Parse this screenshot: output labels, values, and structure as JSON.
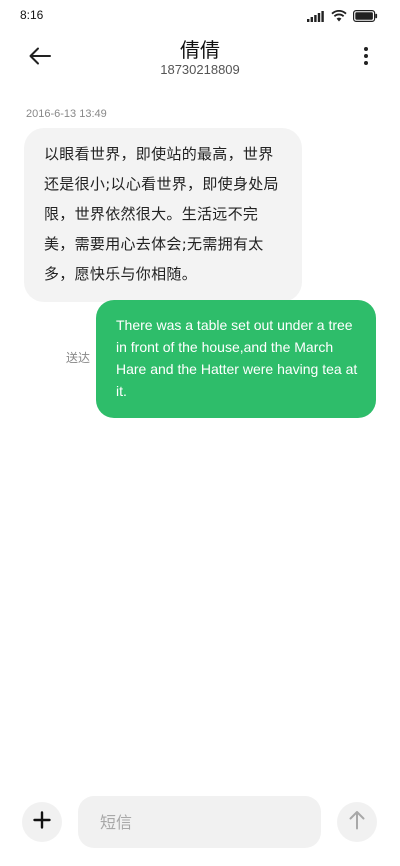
{
  "status_bar": {
    "time": "8:16",
    "signal_icon": "signal-icon",
    "wifi_icon": "wifi-icon",
    "battery_icon": "battery-icon"
  },
  "header": {
    "back_icon": "arrow-left-icon",
    "contact_name": "倩倩",
    "contact_number": "18730218809",
    "more_icon": "more-vertical-icon"
  },
  "conversation": {
    "timestamp": "2016-6-13  13:49",
    "messages": [
      {
        "direction": "incoming",
        "text": "以眼看世界，即使站的最高，世界还是很小;以心看世界，即使身处局限，世界依然很大。生活远不完美，需要用心去体会;无需拥有太多，愿快乐与你相随。"
      },
      {
        "direction": "outgoing",
        "status": "送达",
        "text": "There was a table set out under a tree in front of the house,and the March Hare and the Hatter were having tea at it."
      }
    ]
  },
  "composer": {
    "add_icon": "plus-icon",
    "placeholder": "短信",
    "value": "",
    "send_icon": "arrow-up-icon"
  },
  "colors": {
    "outgoing_bubble": "#2ebd6a",
    "incoming_bubble": "#f3f3f3",
    "composer_bg": "#f1f1f1"
  }
}
